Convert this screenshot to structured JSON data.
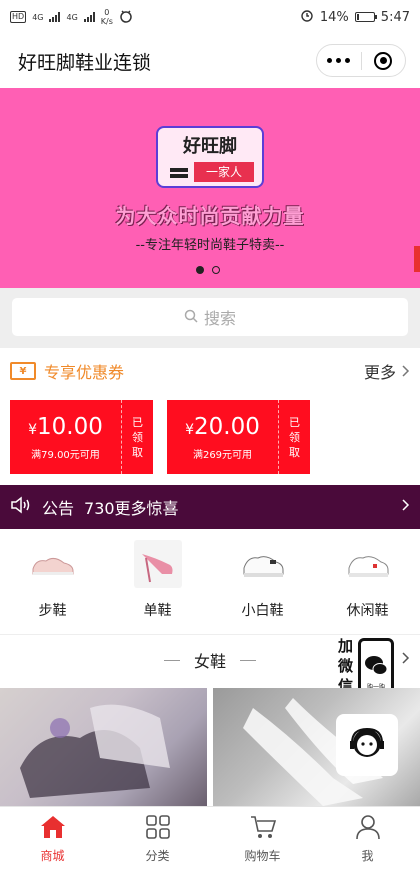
{
  "status_bar": {
    "hd": "HD",
    "net1": "4G",
    "net2": "4G",
    "speed_value": "0",
    "speed_unit": "K/s",
    "battery_percent": "14%",
    "battery_level": 0.14,
    "time": "5:47"
  },
  "header": {
    "title": "好旺脚鞋业连锁"
  },
  "banner": {
    "logo_title": "好旺脚",
    "logo_sub": "一家人",
    "slogan": "为大众时尚贡献力量",
    "subtitle": "--专注年轻时尚鞋子特卖--",
    "slide_count": 2,
    "active_slide": 1,
    "bg_color": "#ff5fb4"
  },
  "search": {
    "placeholder": "搜索"
  },
  "coupons": {
    "title": "专享优惠券",
    "more": "更多",
    "accent_color": "#f08a2a",
    "items": [
      {
        "currency": "¥",
        "amount": "10.00",
        "condition": "满79.00元可用",
        "status": "已领取"
      },
      {
        "currency": "¥",
        "amount": "20.00",
        "condition": "满269元可用",
        "status": "已领取"
      }
    ]
  },
  "notice": {
    "label": "公告",
    "text": "730更多惊喜"
  },
  "categories": [
    {
      "label": "步鞋",
      "icon": "canvas-shoe-icon"
    },
    {
      "label": "单鞋",
      "icon": "high-heel-icon"
    },
    {
      "label": "小白鞋",
      "icon": "white-sneaker-icon"
    },
    {
      "label": "休闲鞋",
      "icon": "casual-sneaker-icon"
    }
  ],
  "section": {
    "title": "女鞋"
  },
  "float_contact": {
    "side_text": [
      "加",
      "微",
      "信"
    ],
    "phone_caption": "购一购"
  },
  "tabbar": {
    "active_color": "#e83030",
    "items": [
      {
        "label": "商城",
        "icon": "home-icon"
      },
      {
        "label": "分类",
        "icon": "category-grid-icon"
      },
      {
        "label": "购物车",
        "icon": "cart-icon"
      },
      {
        "label": "我",
        "icon": "profile-icon"
      }
    ]
  }
}
